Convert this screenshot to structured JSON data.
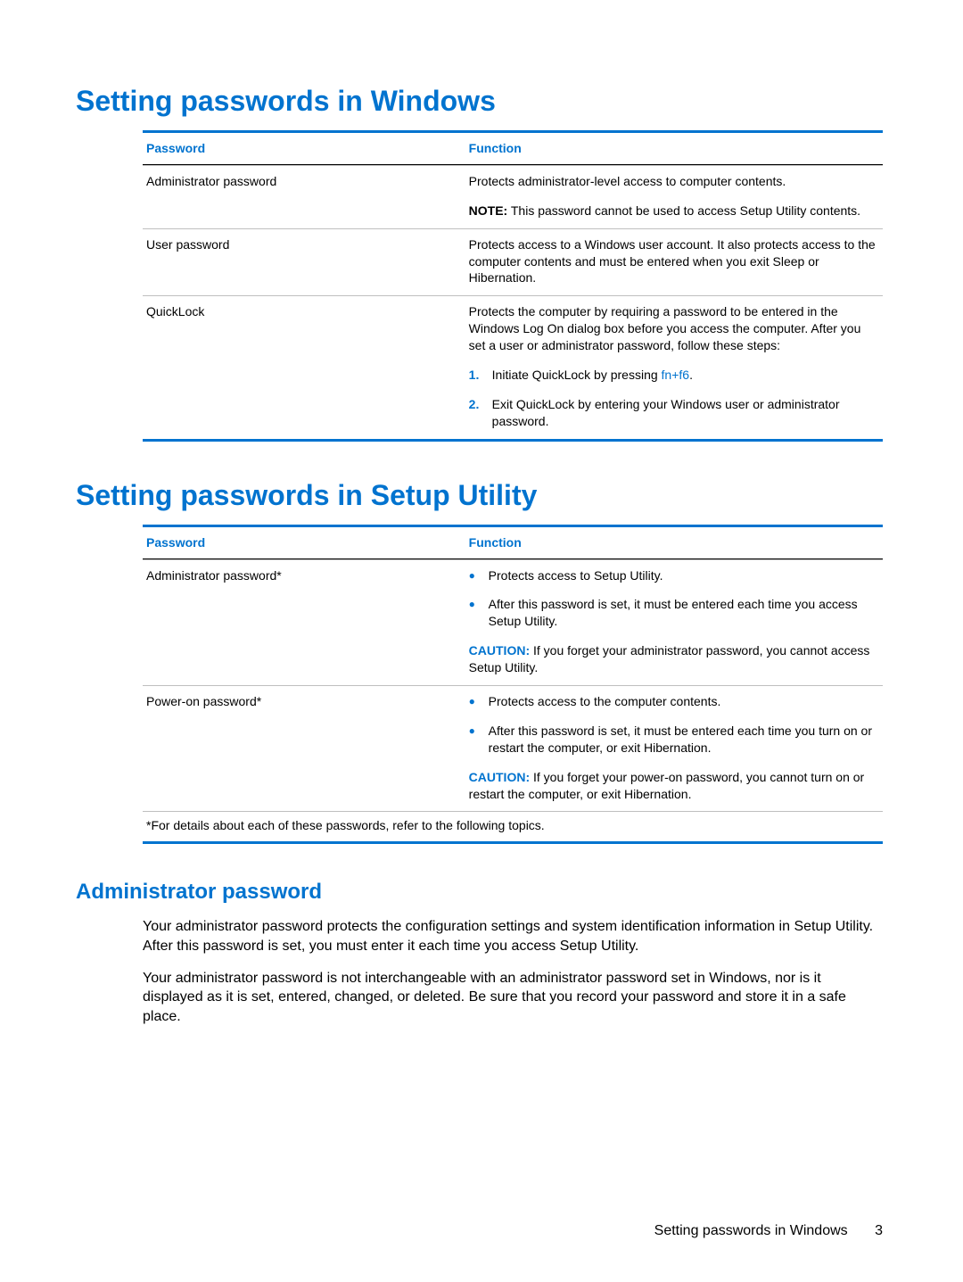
{
  "section1": {
    "title": "Setting passwords in Windows",
    "head_password": "Password",
    "head_function": "Function",
    "rows": {
      "admin": {
        "name": "Administrator password",
        "desc": "Protects administrator-level access to computer contents.",
        "note_label": "NOTE:",
        "note_text": " This password cannot be used to access Setup Utility contents."
      },
      "user": {
        "name": "User password",
        "desc": "Protects access to a Windows user account. It also protects access to the computer contents and must be entered when you exit Sleep or Hibernation."
      },
      "quicklock": {
        "name": "QuickLock",
        "desc": "Protects the computer by requiring a password to be entered in the Windows Log On dialog box before you access the computer. After you set a user or administrator password, follow these steps:",
        "step1_num": "1.",
        "step1_text_a": "Initiate QuickLock by pressing ",
        "step1_key": "fn+f6",
        "step1_text_b": ".",
        "step2_num": "2.",
        "step2_text": "Exit QuickLock by entering your Windows user or administrator password."
      }
    }
  },
  "section2": {
    "title": "Setting passwords in Setup Utility",
    "head_password": "Password",
    "head_function": "Function",
    "rows": {
      "admin": {
        "name": "Administrator password*",
        "b1": "Protects access to Setup Utility.",
        "b2": "After this password is set, it must be entered each time you access Setup Utility.",
        "caution_label": "CAUTION:",
        "caution_text": " If you forget your administrator password, you cannot access Setup Utility."
      },
      "power": {
        "name": "Power-on password*",
        "b1": "Protects access to the computer contents.",
        "b2": "After this password is set, it must be entered each time you turn on or restart the computer, or exit Hibernation.",
        "caution_label": "CAUTION:",
        "caution_text": " If you forget your power-on password, you cannot turn on or restart the computer, or exit Hibernation."
      }
    },
    "footnote": "*For details about each of these passwords, refer to the following topics."
  },
  "section3": {
    "title": "Administrator password",
    "p1": "Your administrator password protects the configuration settings and system identification information in Setup Utility. After this password is set, you must enter it each time you access Setup Utility.",
    "p2": "Your administrator password is not interchangeable with an administrator password set in Windows, nor is it displayed as it is set, entered, changed, or deleted. Be sure that you record your password and store it in a safe place."
  },
  "footer": {
    "text": "Setting passwords in Windows",
    "page": "3"
  }
}
